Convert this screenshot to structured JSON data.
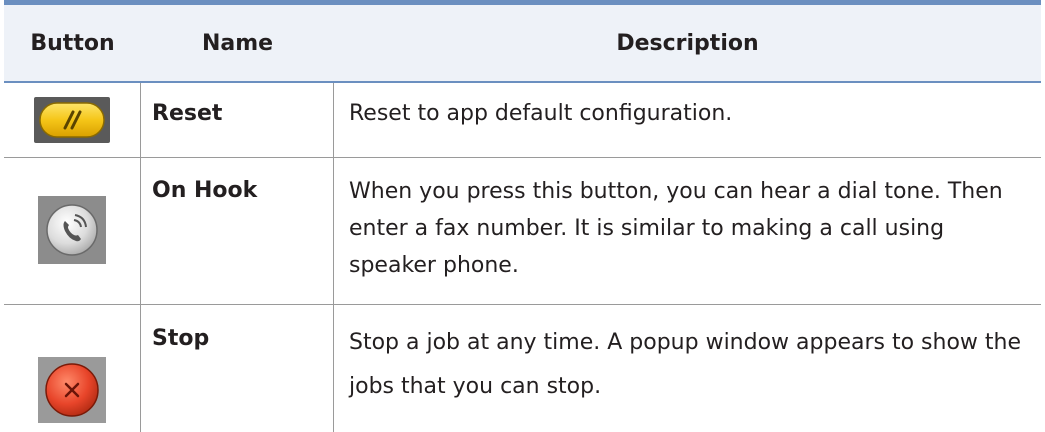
{
  "table": {
    "headers": {
      "button": "Button",
      "name": "Name",
      "description": "Description"
    },
    "rows": [
      {
        "icon": "reset-icon",
        "name": "Reset",
        "description": "Reset to app default configuration."
      },
      {
        "icon": "on-hook-icon",
        "name": "On Hook",
        "description": "When you press this button, you can hear a dial tone. Then enter a fax number. It is similar to making a call using speaker phone."
      },
      {
        "icon": "stop-icon",
        "name": "Stop",
        "description": "Stop a job at any time. A popup window appears to show the jobs that you can stop."
      }
    ]
  },
  "colors": {
    "header_rule": "#6b8fc0",
    "header_bg": "#eef2f8",
    "reset_button": "#f5c518",
    "stop_button": "#e8452a"
  }
}
